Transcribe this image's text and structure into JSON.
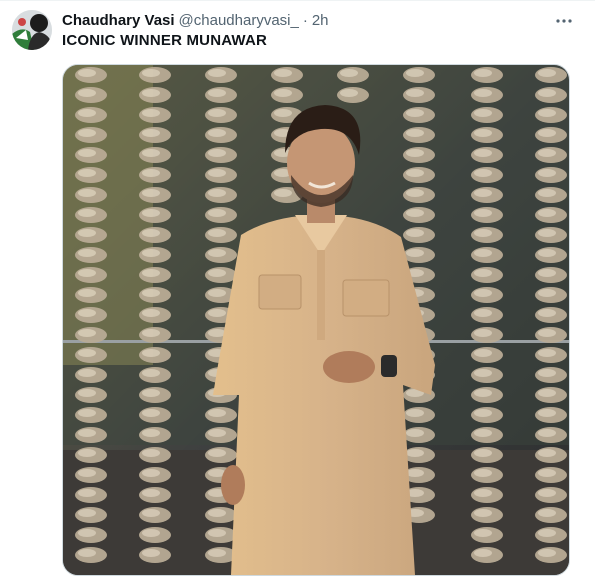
{
  "tweet": {
    "author_name": "Chaudhary Vasi",
    "author_handle": "@chaudharyvasi_",
    "separator": "·",
    "time": "2h",
    "text": "ICONIC WINNER MUNAWAR"
  },
  "icons": {
    "avatar": "profile-avatar",
    "more": "more-horizontal-icon"
  },
  "media": {
    "description_kind": "photo"
  },
  "colors": {
    "text": "#0f1419",
    "secondary": "#536471",
    "border": "#cfd9de"
  }
}
